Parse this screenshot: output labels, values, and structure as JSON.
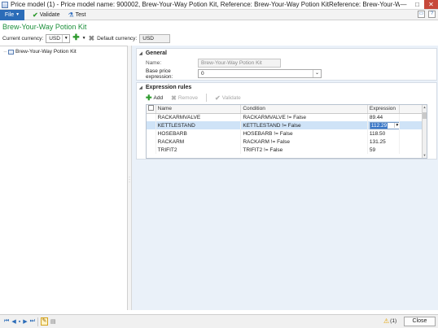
{
  "window": {
    "title": "Price model (1) - Price model name: 900002, Brew-Your-Way Potion Kit, Reference: Brew-Your-Way Potion KitReference: Brew-Your-Wa...",
    "min_glyph": "—",
    "max_glyph": "□",
    "close_glyph": "✕"
  },
  "ribbon": {
    "file_label": "File",
    "file_caret": "▼",
    "validate_label": "Validate",
    "test_label": "Test"
  },
  "form": {
    "title": "Brew-Your-Way Potion Kit",
    "current_currency_label": "Current currency:",
    "current_currency_value": "USD",
    "default_currency_label": "Default currency:",
    "default_currency_value": "USD"
  },
  "tree": {
    "items": [
      {
        "dots": "····",
        "label": "Brew-Your-Way Potion Kit"
      }
    ]
  },
  "general": {
    "header": "General",
    "name_label": "Name:",
    "name_value": "Brew-Your-Way Potion Kit",
    "base_price_label": "Base price expression:",
    "base_price_value": "0"
  },
  "expression_rules": {
    "header": "Expression rules",
    "add_label": "Add",
    "remove_label": "Remove",
    "validate_label": "Validate",
    "columns": [
      "Name",
      "Condition",
      "Expression"
    ],
    "rows": [
      {
        "name": "RACKARMVALVE",
        "condition": "RACKARMVALVE != False",
        "expression": "89.44"
      },
      {
        "name": "KETTLESTAND",
        "condition": "KETTLESTAND != False",
        "expression": "112.29"
      },
      {
        "name": "HOSEBARB",
        "condition": "HOSEBARB != False",
        "expression": "118.50"
      },
      {
        "name": "RACKARM",
        "condition": "RACKARM != False",
        "expression": "131.25"
      },
      {
        "name": "TRIFIT2",
        "condition": "TRIFIT2 != False",
        "expression": "59"
      }
    ]
  },
  "status": {
    "warning_count": "(1)",
    "close_label": "Close"
  },
  "colors": {
    "accent_blue": "#2b6cb8",
    "title_green": "#1c8f3a",
    "selection": "#cfe3f7",
    "detail_background": "#eaf1f9"
  }
}
